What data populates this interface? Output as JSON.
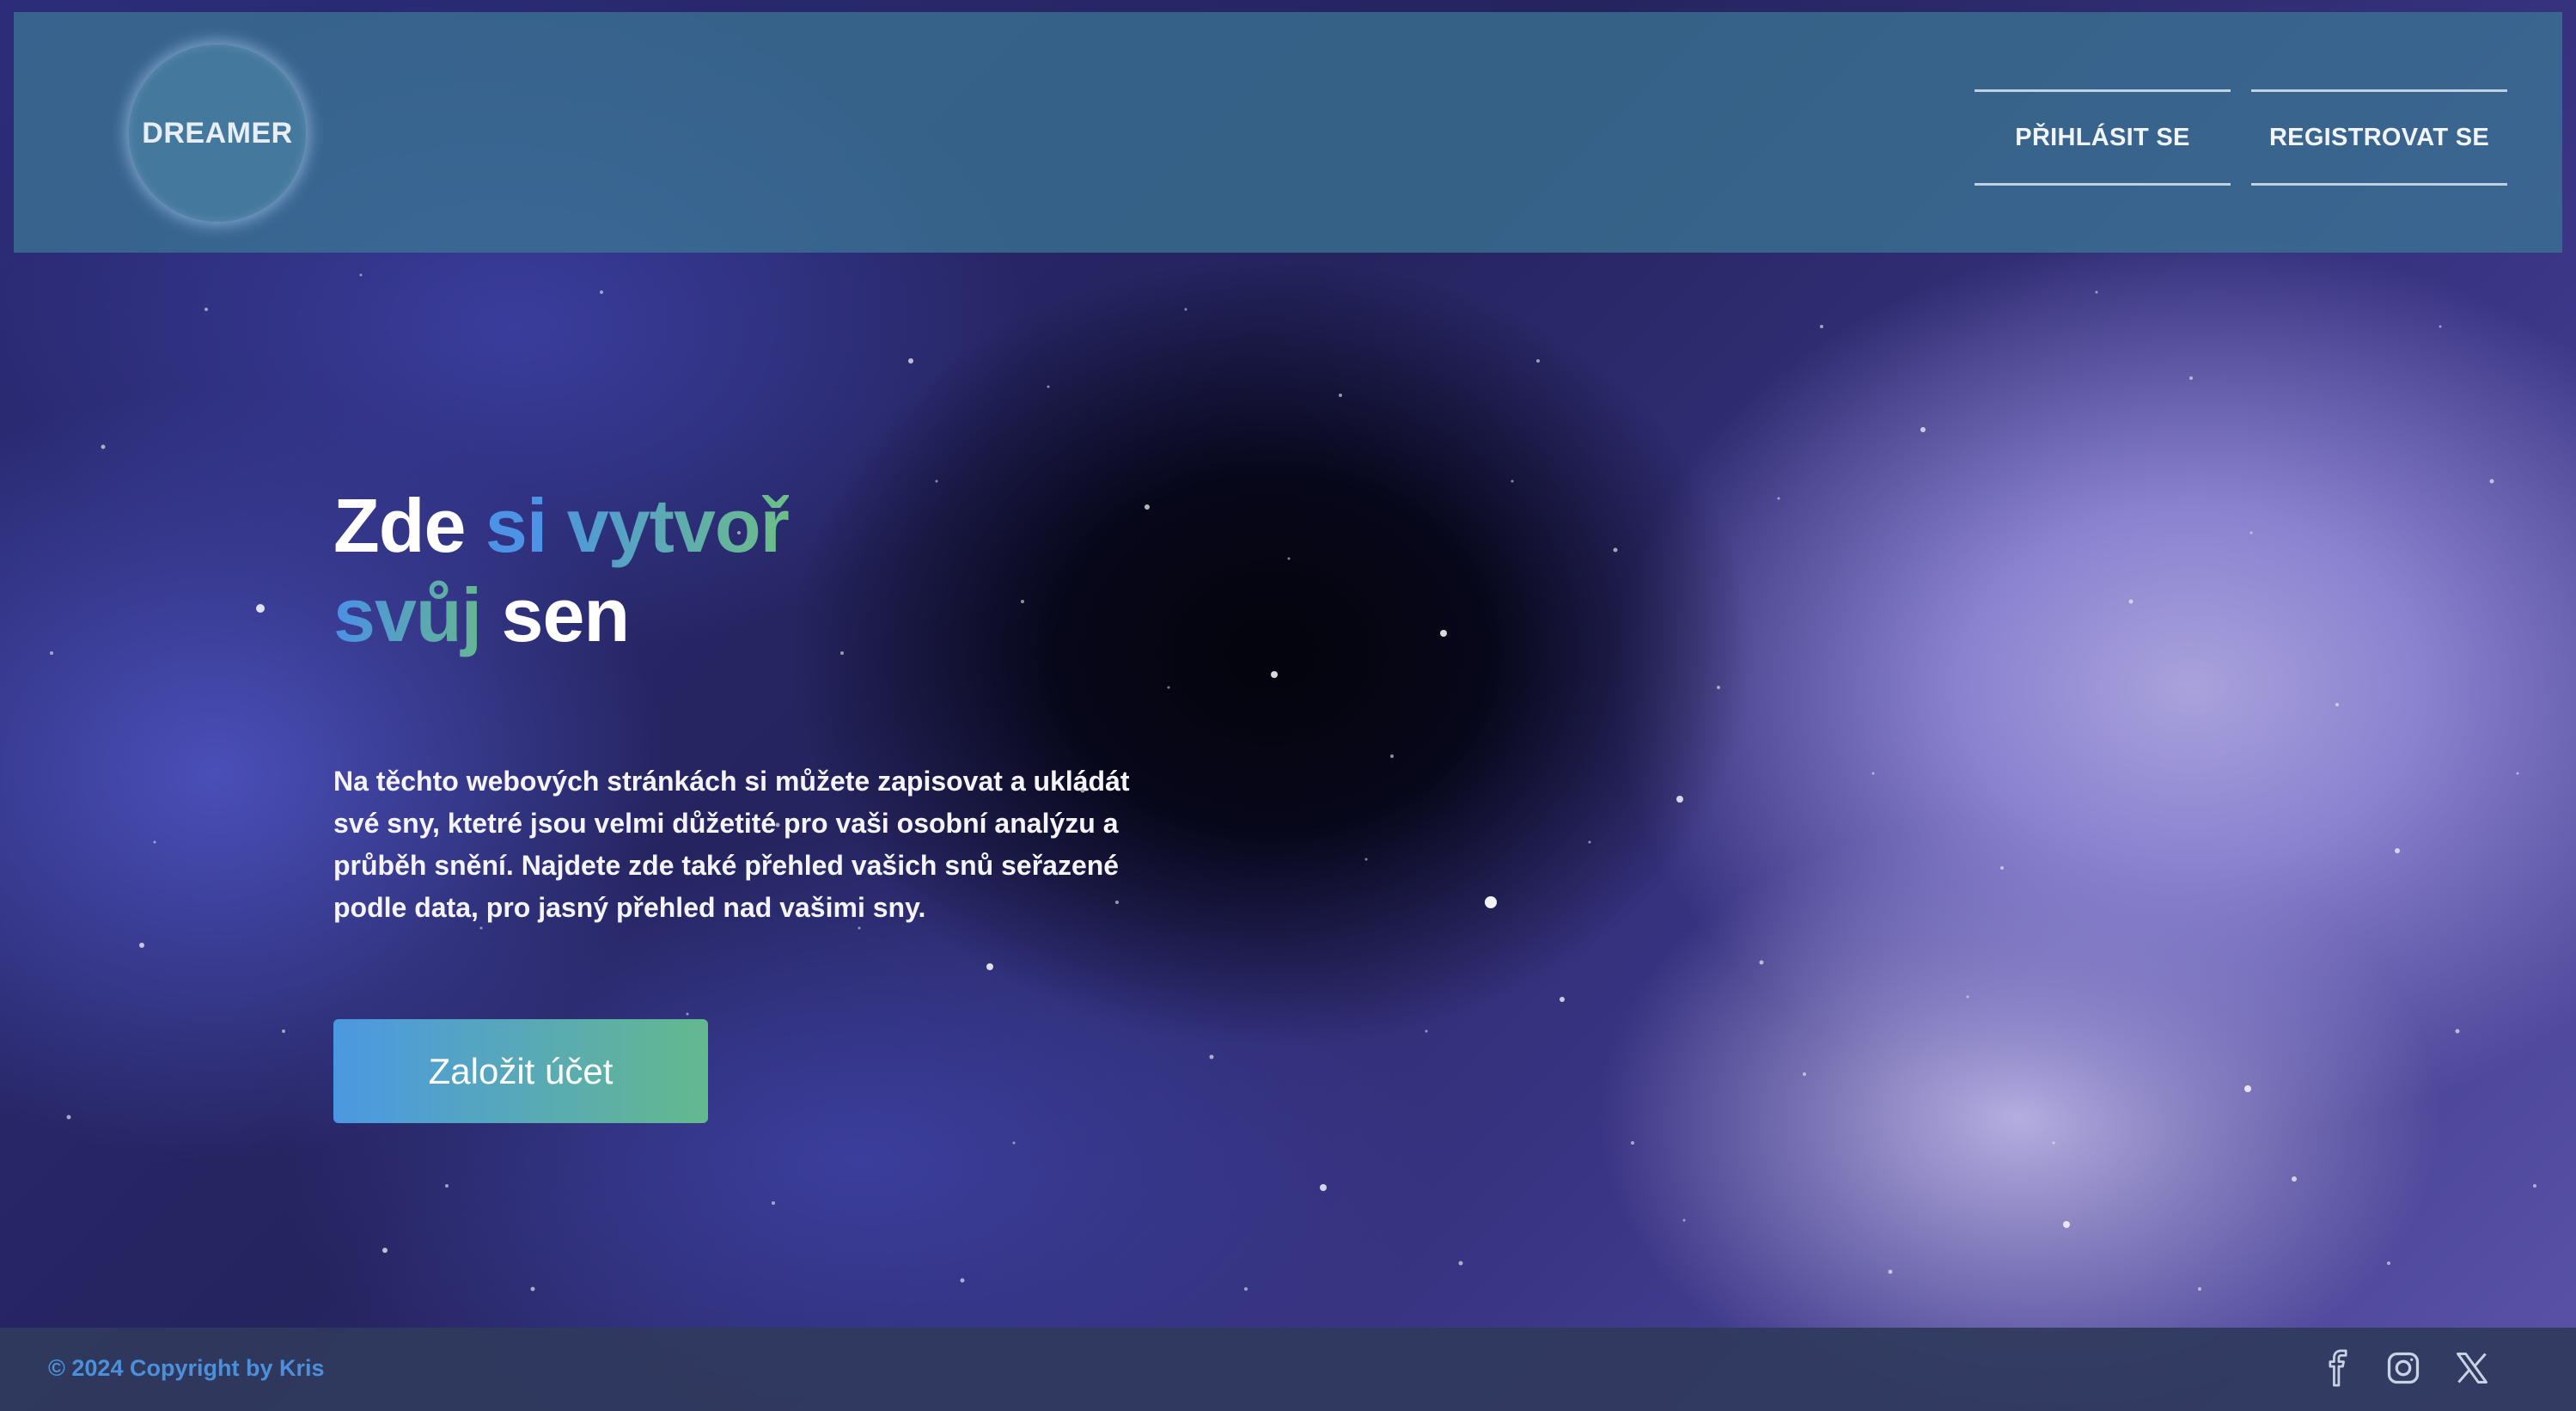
{
  "header": {
    "logo_text": "DREAMER",
    "login_label": "PŘIHLÁSIT SE",
    "register_label": "REGISTROVAT SE"
  },
  "hero": {
    "title_word_1": "Zde",
    "title_word_2": "si",
    "title_word_3": "vytvoř",
    "title_word_4": "svůj",
    "title_word_5": "sen",
    "description": "Na těchto webových stránkách si můžete zapisovat a ukládát své sny, ktetré jsou velmi důžetité pro vaši osobní analýzu a průběh snění. Najdete zde také přehled vašich snů seřazené podle data, pro jasný přehled nad vašimi sny.",
    "cta_label": "Založit účet"
  },
  "footer": {
    "copyright": "© 2024 Copyright by Kris",
    "social_icons": [
      "facebook-icon",
      "instagram-icon",
      "x-twitter-icon"
    ]
  },
  "colors": {
    "accent_blue": "#4c93e6",
    "accent_green": "#6cbd8a",
    "header_bg": "#3b7896",
    "footer_bg": "#303a5c"
  }
}
